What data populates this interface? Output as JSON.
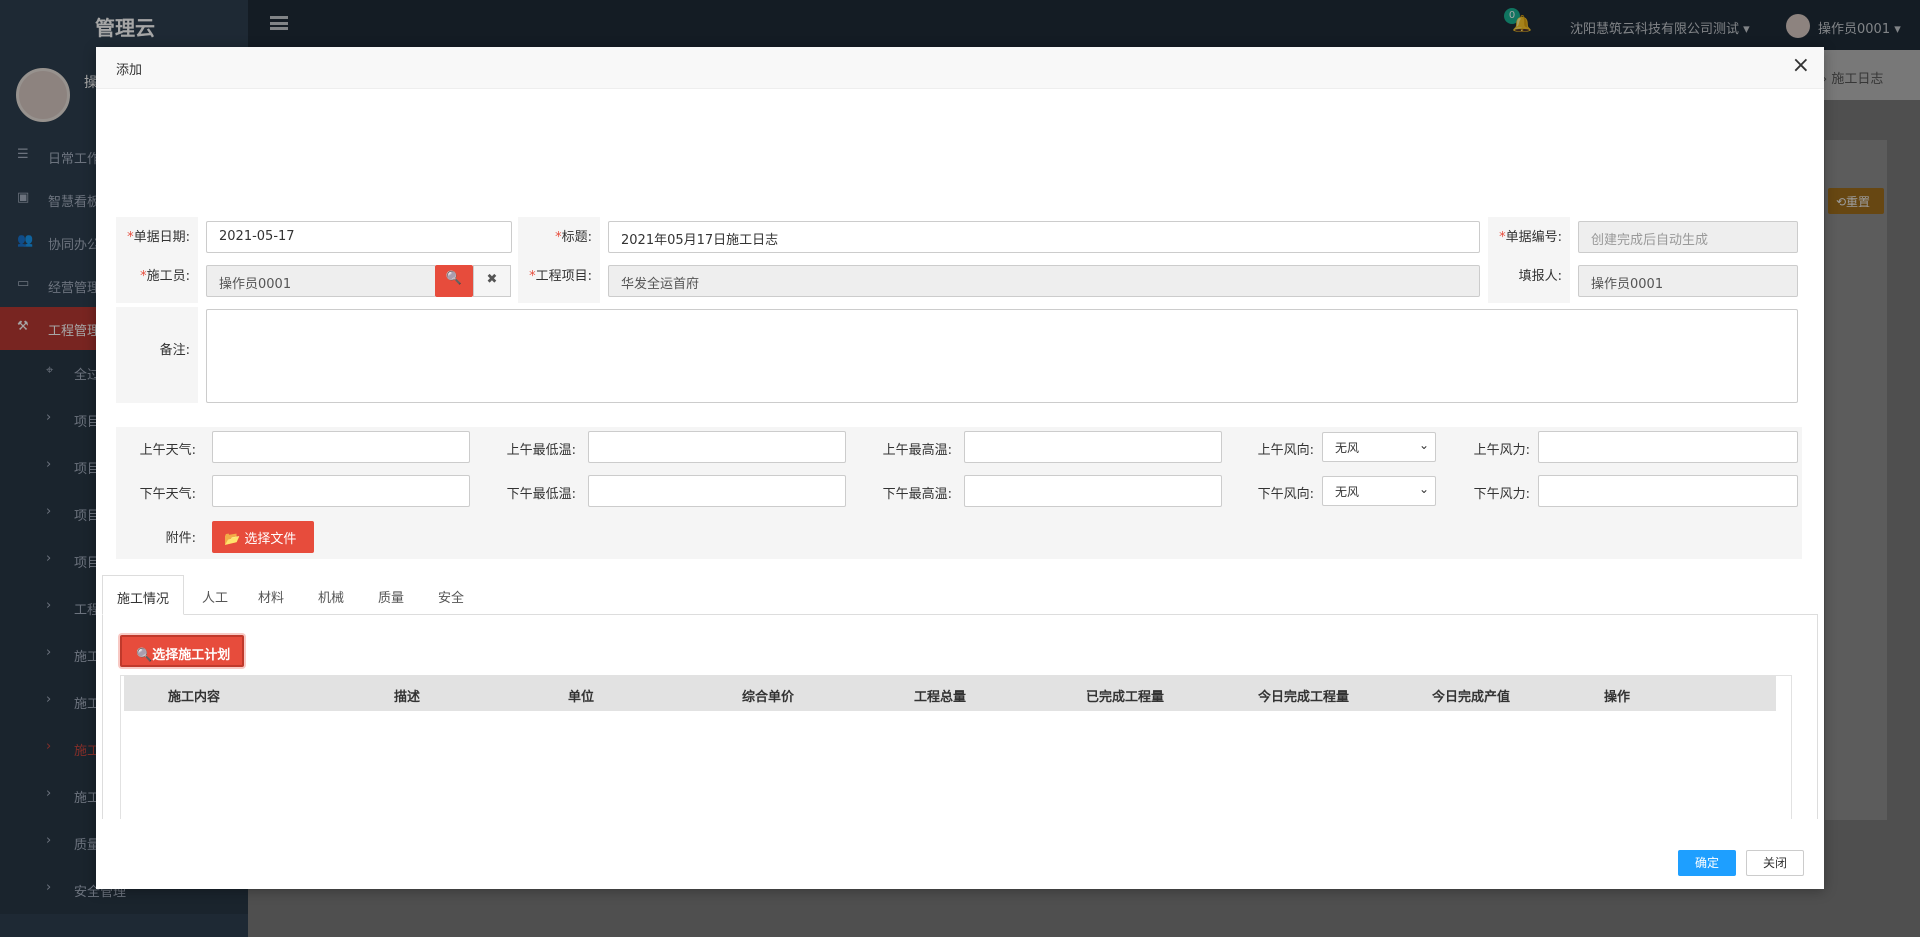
{
  "app": {
    "brand": "管理云",
    "profile_name": "操",
    "breadcrumb": "› 施工日志",
    "reset_label": "⟲重置"
  },
  "topbar": {
    "notification_count": "0",
    "company": "沈阳慧筑云科技有限公司测试 ▾",
    "user": "操作员0001 ▾"
  },
  "sidebar": {
    "items": [
      {
        "label": "日常工作",
        "icon": "list-icon"
      },
      {
        "label": "智慧看板",
        "icon": "dashboard-icon"
      },
      {
        "label": "协同办公",
        "icon": "users-icon"
      },
      {
        "label": "经营管理",
        "icon": "monitor-icon"
      },
      {
        "label": "工程管理",
        "icon": "gavel-icon"
      }
    ],
    "subitems": [
      "全过",
      "项目",
      "项目",
      "项目",
      "项目",
      "工程",
      "施工",
      "施工",
      "施工",
      "施工",
      "质量",
      "安全管理"
    ],
    "sub_first_icon": "crosshair-icon"
  },
  "modal": {
    "title": "添加",
    "close_icon": "×",
    "fields": {
      "date_label": "单据日期:",
      "date_value": "2021-05-17",
      "title_label": "标题:",
      "title_value": "2021年05月17日施工日志",
      "code_label": "单据编号:",
      "code_placeholder": "创建完成后自动生成",
      "worker_label": "施工员:",
      "worker_value": "操作员0001",
      "project_label": "工程项目:",
      "project_value": "华发全运首府",
      "reporter_label": "填报人:",
      "reporter_value": "操作员0001",
      "remark_label": "备注:",
      "required_mark": "*"
    },
    "weather": {
      "am_weather": "上午天气:",
      "am_low": "上午最低温:",
      "am_high": "上午最高温:",
      "am_wind_dir": "上午风向:",
      "am_wind_dir_value": "无风",
      "am_wind_force": "上午风力:",
      "pm_weather": "下午天气:",
      "pm_low": "下午最低温:",
      "pm_high": "下午最高温:",
      "pm_wind_dir": "下午风向:",
      "pm_wind_dir_value": "无风",
      "pm_wind_force": "下午风力:",
      "attach_label": "附件:",
      "select_file": "选择文件"
    },
    "tabs": [
      "施工情况",
      "人工",
      "材料",
      "机械",
      "质量",
      "安全"
    ],
    "select_plan": "选择施工计划",
    "table_headers": [
      "施工内容",
      "描述",
      "单位",
      "综合单价",
      "工程总量",
      "已完成工程量",
      "今日完成工程量",
      "今日完成产值",
      "操作"
    ],
    "ok": "确定",
    "close": "关闭"
  }
}
